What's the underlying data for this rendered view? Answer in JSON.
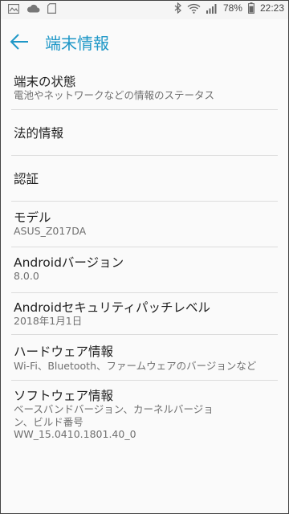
{
  "status_bar": {
    "battery": "78%",
    "time": "22:23",
    "icons": [
      "image-icon",
      "cloud-icon",
      "sd-card-icon",
      "bluetooth-icon",
      "wifi-icon",
      "signal-icon",
      "battery-icon"
    ]
  },
  "toolbar": {
    "title": "端末情報",
    "back_icon": "arrow-left-icon",
    "accent": "#1e97c7"
  },
  "items": [
    {
      "title": "端末の状態",
      "subtitle": "電池やネットワークなどの情報のステータス"
    },
    {
      "title": "法的情報",
      "subtitle": ""
    },
    {
      "title": "認証",
      "subtitle": ""
    },
    {
      "title": "モデル",
      "subtitle": "ASUS_Z017DA"
    },
    {
      "title": "Androidバージョン",
      "subtitle": "8.0.0"
    },
    {
      "title": "Androidセキュリティパッチレベル",
      "subtitle": "2018年1月1日"
    },
    {
      "title": "ハードウェア情報",
      "subtitle": "Wi-Fi、Bluetooth、ファームウェアのバージョンなど"
    },
    {
      "title": "ソフトウェア情報",
      "subtitle": "ベースバンドバージョン、カーネルバージョ\nン、ビルド番号\nWW_15.0410.1801.40_0"
    }
  ]
}
